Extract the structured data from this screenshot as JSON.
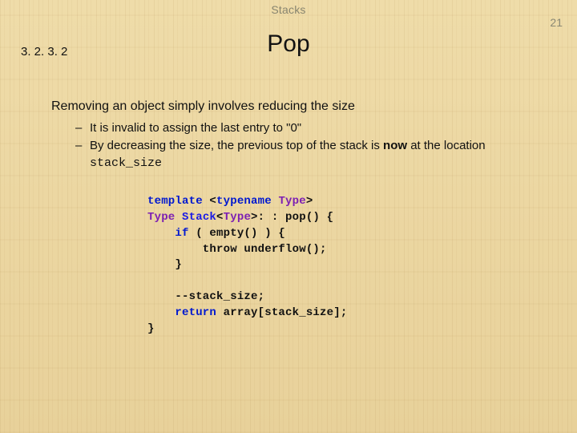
{
  "header": {
    "label": "Stacks",
    "page_number": "21"
  },
  "section": {
    "number": "3. 2. 3. 2",
    "title": "Pop"
  },
  "content": {
    "intro": "Removing an object simply involves reducing the size",
    "bullets": [
      {
        "dash": "–",
        "text_html": "It is invalid to assign the last entry to \"0\""
      },
      {
        "dash": "–",
        "text_html": "By decreasing the size, the previous top of the stack is <b>now</b> at the location <span class=\"mono\">stack_size</span>"
      }
    ]
  },
  "code": {
    "l1a": "template",
    "l1b": " <",
    "l1c": "typename",
    "l1d": " ",
    "l1e": "Type",
    "l1f": ">",
    "l2a": "Type",
    "l2b": " ",
    "l2c": "Stack",
    "l2d": "<",
    "l2e": "Type",
    "l2f": ">: : pop() {",
    "l3a": "    ",
    "l3b": "if",
    "l3c": " ( empty() ) {",
    "l4": "        throw underflow();",
    "l5": "    }",
    "blank": "",
    "l6": "    --stack_size;",
    "l7a": "    ",
    "l7b": "return",
    "l7c": " array[stack_size];",
    "l8": "}"
  }
}
